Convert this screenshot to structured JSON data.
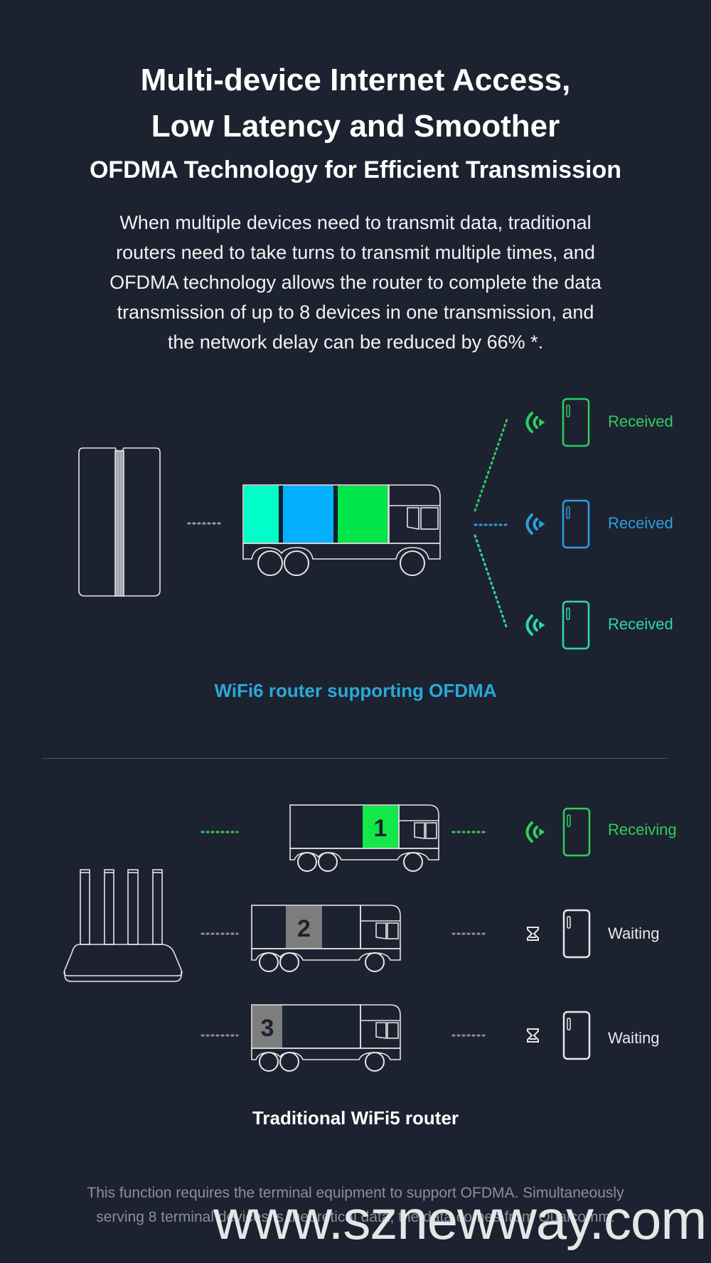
{
  "header": {
    "title_line1": "Multi-device Internet Access,",
    "title_line2": "Low Latency and Smoother",
    "subtitle": "OFDMA Technology for Efficient Transmission",
    "body_lines": [
      "When multiple devices need to transmit data, traditional",
      "routers need to take turns to transmit multiple times, and",
      "OFDMA technology allows the router to complete the data",
      "transmission of up to 8 devices in one transmission, and",
      "the network delay can be reduced by 66% *."
    ]
  },
  "wifi6": {
    "caption": "WiFi6 router supporting OFDMA",
    "cargo_colors": [
      "#00ffc8",
      "#05b1ff",
      "#00e64a"
    ],
    "devices": [
      {
        "status": "Received",
        "color": "#2fce5e",
        "icon": "wifi-signal-icon"
      },
      {
        "status": "Received",
        "color": "#2c9fe0",
        "icon": "wifi-signal-icon"
      },
      {
        "status": "Received",
        "color": "#2ed8a6",
        "icon": "wifi-signal-icon"
      }
    ]
  },
  "wifi5": {
    "caption": "Traditional WiFi5 router",
    "trucks": [
      {
        "number": "1",
        "status": "Receiving",
        "icon": "wifi-signal-icon",
        "color": "#2fce5e",
        "cargo_color": "#13e84a"
      },
      {
        "number": "2",
        "status": "Waiting",
        "icon": "hourglass-icon",
        "color": "#e8e8e8",
        "cargo_color": "#7d7d7d"
      },
      {
        "number": "3",
        "status": "Waiting",
        "icon": "hourglass-icon",
        "color": "#e8e8e8",
        "cargo_color": "#7d7d7d"
      }
    ]
  },
  "footnote_lines": [
    "This function requires the terminal equipment to support OFDMA. Simultaneously",
    "serving 8 terminal devices is theoretical data, the data comes from Qualcomm."
  ],
  "watermark": "www.sznewway.com",
  "colors": {
    "background": "#1d2230",
    "line": "#e6e6e6",
    "dots": "#8a8f99"
  }
}
